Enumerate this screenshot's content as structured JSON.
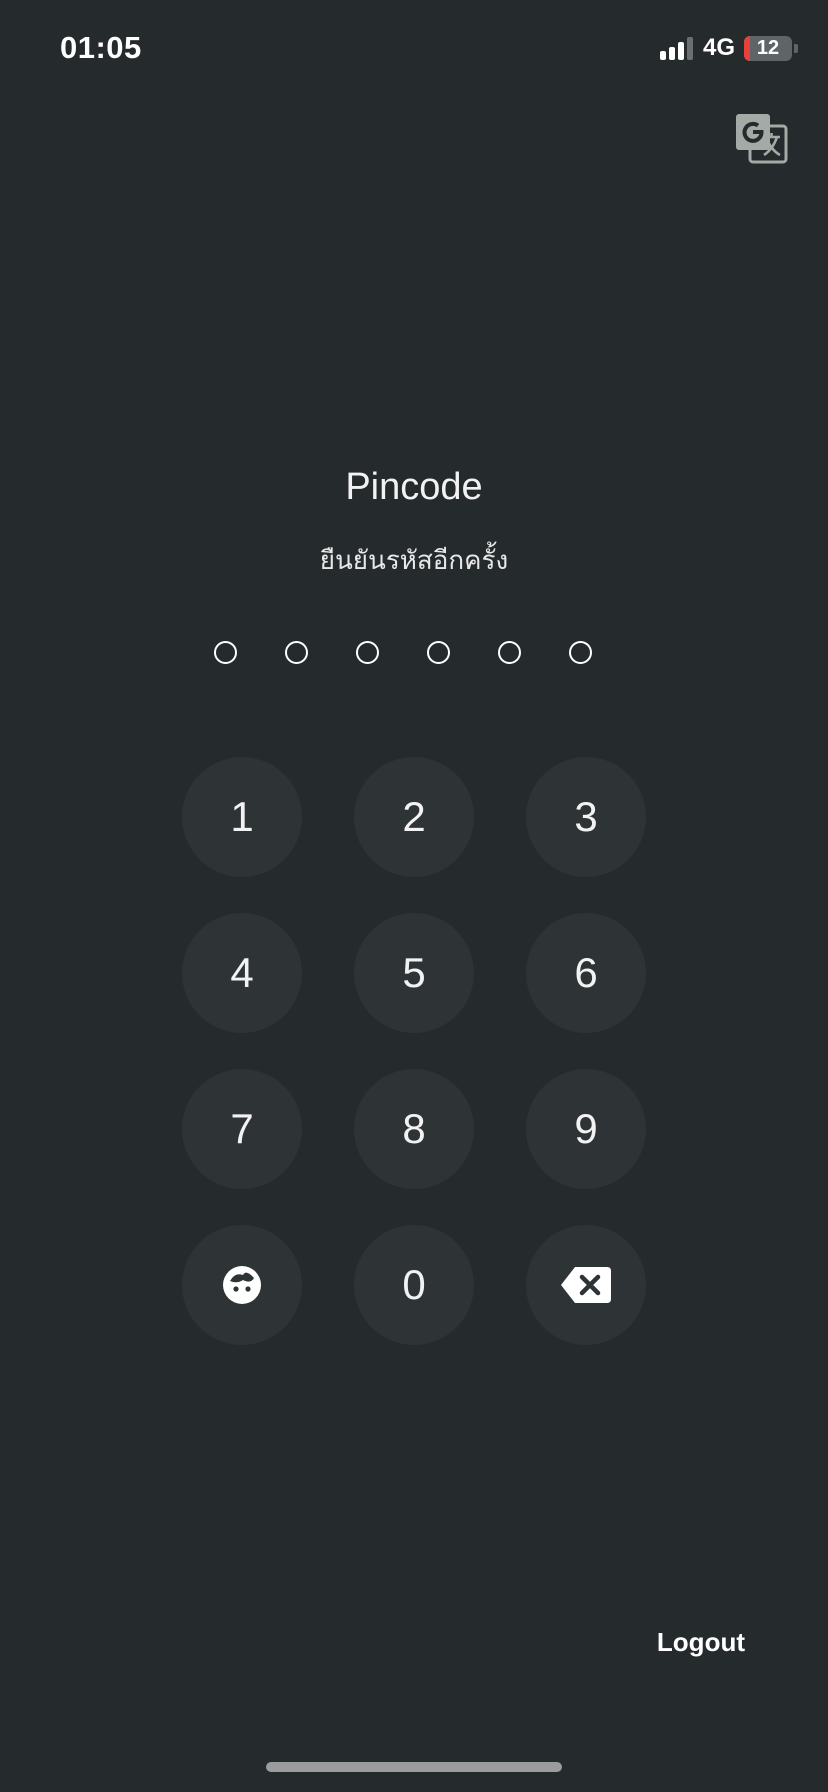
{
  "status_bar": {
    "time": "01:05",
    "network": "4G",
    "battery_level": "12",
    "battery_fraction": 0.12,
    "battery_color": "#e8403a"
  },
  "translate_icon": "google-translate-icon",
  "pincode": {
    "title": "Pincode",
    "subtitle": "ยืนยันรหัสอีกครั้ง",
    "length": 6,
    "filled": 0
  },
  "keypad": {
    "keys": [
      "1",
      "2",
      "3",
      "4",
      "5",
      "6",
      "7",
      "8",
      "9",
      "0"
    ],
    "face_id_icon": "face-id-icon",
    "delete_icon": "backspace-icon"
  },
  "logout_label": "Logout",
  "colors": {
    "background": "#252a2c",
    "key_background": "#2e3436",
    "text": "#ffffff"
  }
}
